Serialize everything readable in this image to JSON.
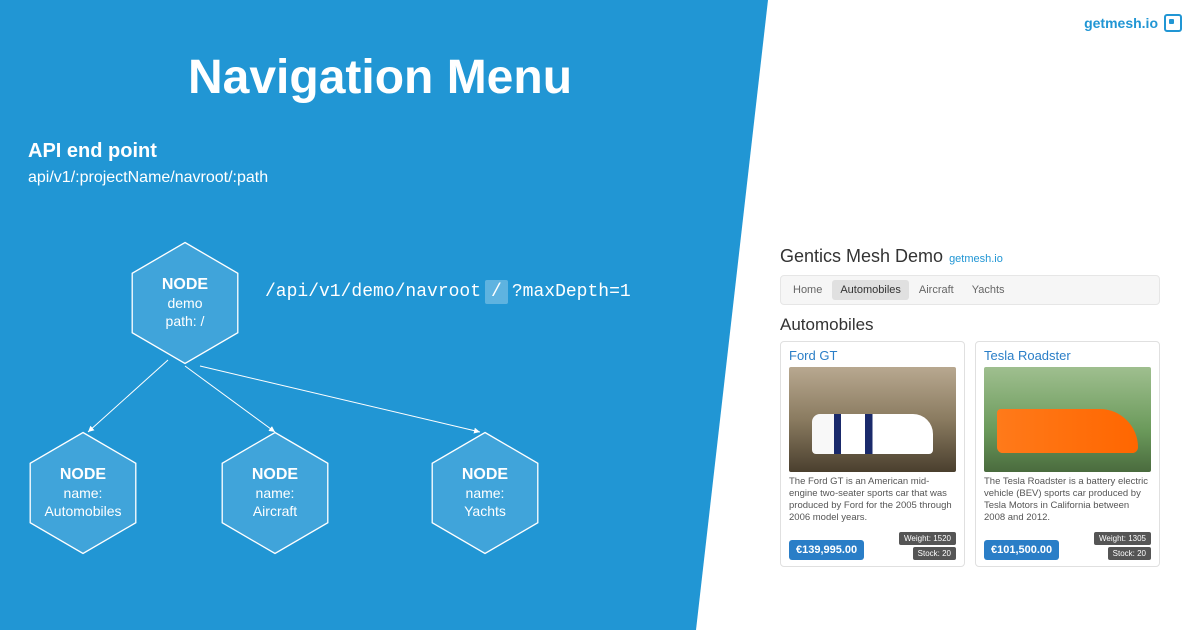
{
  "logo_text": "getmesh.io",
  "title": "Navigation Menu",
  "api": {
    "label": "API end point",
    "path": "api/v1/:projectName/navroot/:path"
  },
  "endpoint_example": {
    "pre": "/api/v1/demo/navroot",
    "slash": "/",
    "post": "?maxDepth=1"
  },
  "root_node": {
    "label": "NODE",
    "line1": "demo",
    "line2": "path: /"
  },
  "children": [
    {
      "label": "NODE",
      "line1": "name:",
      "line2": "Automobiles"
    },
    {
      "label": "NODE",
      "line1": "name:",
      "line2": "Aircraft"
    },
    {
      "label": "NODE",
      "line1": "name:",
      "line2": "Yachts"
    }
  ],
  "demo": {
    "title": "Gentics Mesh Demo",
    "link": "getmesh.io",
    "tabs": [
      "Home",
      "Automobiles",
      "Aircraft",
      "Yachts"
    ],
    "active_tab": 1,
    "section": "Automobiles",
    "cards": [
      {
        "title": "Ford GT",
        "desc": "The Ford GT is an American mid-engine two-seater sports car that was produced by Ford for the 2005 through 2006 model years.",
        "price": "€139,995.00",
        "weight": "Weight: 1520",
        "stock": "Stock: 20"
      },
      {
        "title": "Tesla Roadster",
        "desc": "The Tesla Roadster is a battery electric vehicle (BEV) sports car produced by Tesla Motors in California between 2008 and 2012.",
        "price": "€101,500.00",
        "weight": "Weight: 1305",
        "stock": "Stock: 20"
      }
    ]
  }
}
